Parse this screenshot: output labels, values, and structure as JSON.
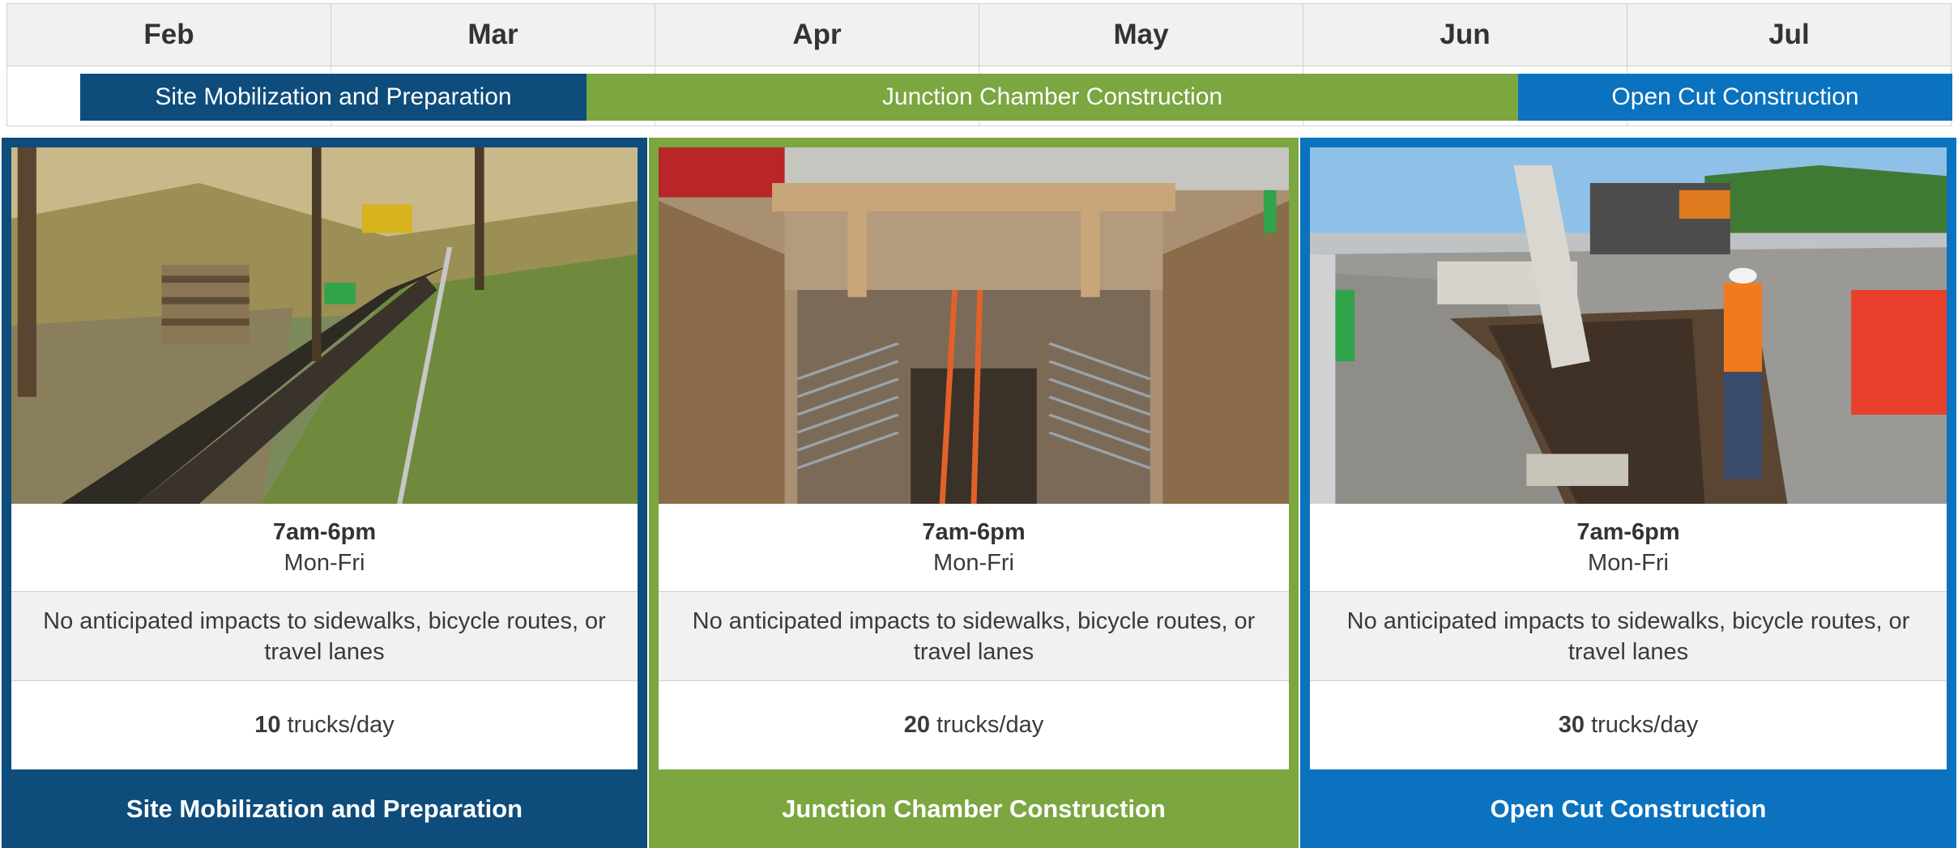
{
  "timeline": {
    "months": [
      "Feb",
      "Mar",
      "Apr",
      "May",
      "Jun",
      "Jul"
    ],
    "phases": [
      {
        "label": "Site Mobilization and Preparation",
        "color": "#0e4c7c"
      },
      {
        "label": "Junction Chamber Construction",
        "color": "#7ba640"
      },
      {
        "label": "Open Cut Construction",
        "color": "#0a72bf"
      }
    ]
  },
  "cards": [
    {
      "hours": "7am-6pm",
      "days": "Mon-Fri",
      "impact": "No anticipated impacts to sidewalks, bicycle routes, or travel lanes",
      "trucks_count": "10",
      "trucks_unit": " trucks/day",
      "title": "Site Mobilization and Preparation",
      "photo": "construction site with silt fence along wooded area"
    },
    {
      "hours": "7am-6pm",
      "days": "Mon-Fri",
      "impact": "No anticipated impacts to sidewalks, bicycle routes, or travel lanes",
      "trucks_count": "20",
      "trucks_unit": " trucks/day",
      "title": "Junction Chamber Construction",
      "photo": "excavated junction chamber with timber shoring and rebar"
    },
    {
      "hours": "7am-6pm",
      "days": "Mon-Fri",
      "impact": "No anticipated impacts to sidewalks, bicycle routes, or travel lanes",
      "trucks_count": "30",
      "trucks_unit": " trucks/day",
      "title": "Open Cut Construction",
      "photo": "excavator digging open trench with worker and dump truck"
    }
  ]
}
